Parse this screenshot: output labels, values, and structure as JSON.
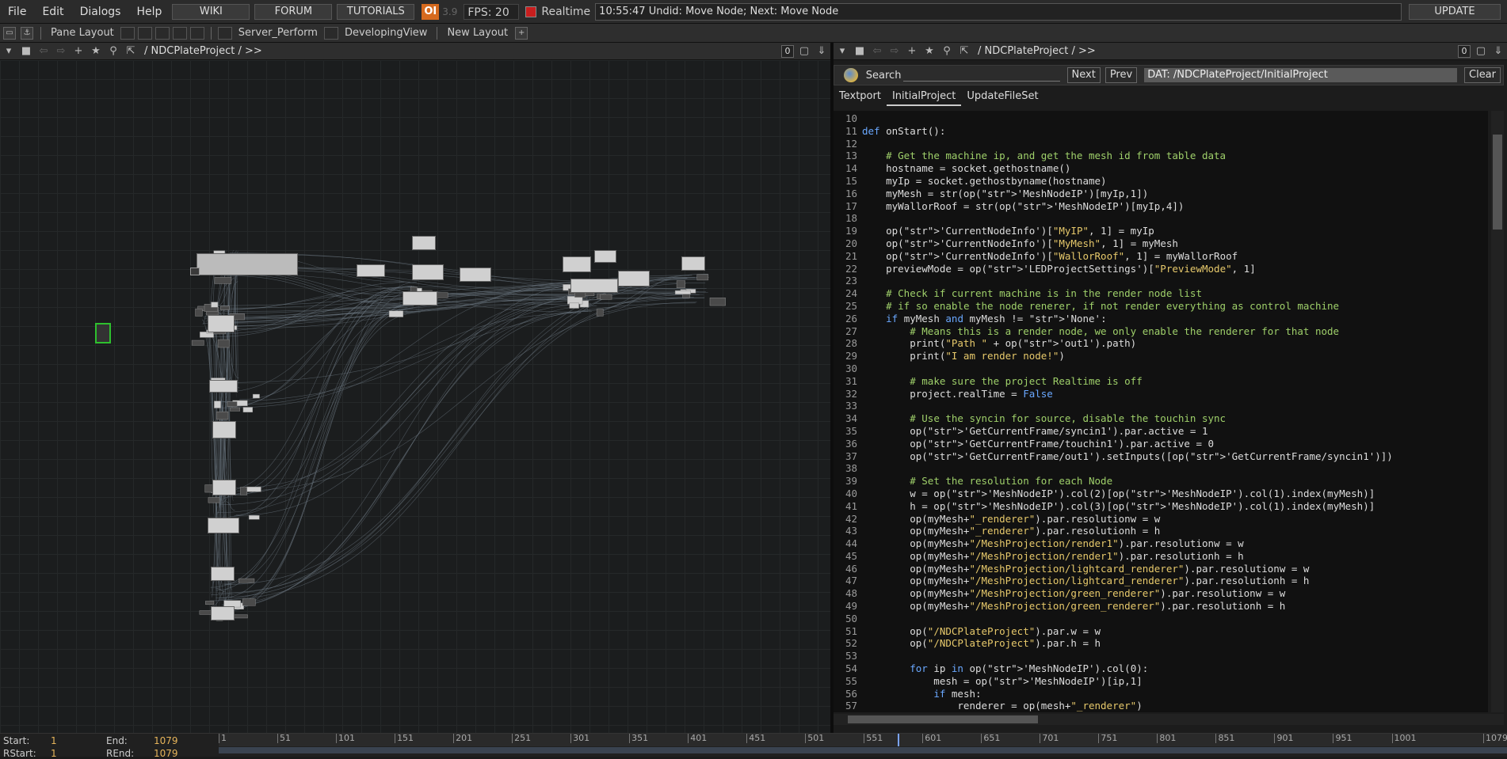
{
  "menu": {
    "file": "File",
    "edit": "Edit",
    "dialogs": "Dialogs",
    "help": "Help",
    "wiki": "WIKI",
    "forum": "FORUM",
    "tutorials": "TUTORIALS",
    "oi": "OI",
    "version": "3.9",
    "fps_label": "FPS:",
    "fps_value": "20",
    "realtime": "Realtime",
    "undo": "10:55:47 Undid: Move Node; Next: Move Node",
    "update": "UPDATE"
  },
  "toolbar": {
    "pane_layout": "Pane Layout",
    "layout1": "Server_Perform",
    "layout2": "DevelopingView",
    "new_layout": "New Layout"
  },
  "left_pane": {
    "path": "/ NDCPlateProject / >>",
    "zoom": "0"
  },
  "right_pane": {
    "path": "/ NDCPlateProject / >>",
    "zoom": "0"
  },
  "search": {
    "label": "Search",
    "next": "Next",
    "prev": "Prev",
    "dat_path": "DAT:  /NDCPlateProject/InitialProject",
    "clear": "Clear"
  },
  "tabs": [
    "Textport",
    "InitialProject",
    "UpdateFileSet"
  ],
  "code": [
    {
      "n": "10",
      "t": ""
    },
    {
      "n": "11",
      "t": "def onStart():"
    },
    {
      "n": "12",
      "t": ""
    },
    {
      "n": "13",
      "t": "    # Get the machine ip, and get the mesh id from table data"
    },
    {
      "n": "14",
      "t": "    hostname = socket.gethostname()"
    },
    {
      "n": "15",
      "t": "    myIp = socket.gethostbyname(hostname)"
    },
    {
      "n": "16",
      "t": "    myMesh = str(op('MeshNodeIP')[myIp,1])"
    },
    {
      "n": "17",
      "t": "    myWallorRoof = str(op('MeshNodeIP')[myIp,4])"
    },
    {
      "n": "18",
      "t": ""
    },
    {
      "n": "19",
      "t": "    op('CurrentNodeInfo')[\"MyIP\", 1] = myIp"
    },
    {
      "n": "20",
      "t": "    op('CurrentNodeInfo')[\"MyMesh\", 1] = myMesh"
    },
    {
      "n": "21",
      "t": "    op('CurrentNodeInfo')[\"WallorRoof\", 1] = myWallorRoof"
    },
    {
      "n": "22",
      "t": "    previewMode = op('LEDProjectSettings')[\"PreviewMode\", 1]"
    },
    {
      "n": "23",
      "t": ""
    },
    {
      "n": "24",
      "t": "    # Check if current machine is in the render node list"
    },
    {
      "n": "25",
      "t": "    # if so enable the node renerer, if not render everything as control machine"
    },
    {
      "n": "26",
      "t": "    if myMesh and myMesh != 'None':"
    },
    {
      "n": "27",
      "t": "        # Means this is a render node, we only enable the renderer for that node"
    },
    {
      "n": "28",
      "t": "        print(\"Path \" + op('out1').path)"
    },
    {
      "n": "29",
      "t": "        print(\"I am render node!\")"
    },
    {
      "n": "30",
      "t": ""
    },
    {
      "n": "31",
      "t": "        # make sure the project Realtime is off"
    },
    {
      "n": "32",
      "t": "        project.realTime = False"
    },
    {
      "n": "33",
      "t": ""
    },
    {
      "n": "34",
      "t": "        # Use the syncin for source, disable the touchin sync"
    },
    {
      "n": "35",
      "t": "        op('GetCurrentFrame/syncin1').par.active = 1"
    },
    {
      "n": "36",
      "t": "        op('GetCurrentFrame/touchin1').par.active = 0"
    },
    {
      "n": "37",
      "t": "        op('GetCurrentFrame/out1').setInputs([op('GetCurrentFrame/syncin1')])"
    },
    {
      "n": "38",
      "t": ""
    },
    {
      "n": "39",
      "t": "        # Set the resolution for each Node"
    },
    {
      "n": "40",
      "t": "        w = op('MeshNodeIP').col(2)[op('MeshNodeIP').col(1).index(myMesh)]"
    },
    {
      "n": "41",
      "t": "        h = op('MeshNodeIP').col(3)[op('MeshNodeIP').col(1).index(myMesh)]"
    },
    {
      "n": "42",
      "t": "        op(myMesh+\"_renderer\").par.resolutionw = w"
    },
    {
      "n": "43",
      "t": "        op(myMesh+\"_renderer\").par.resolutionh = h"
    },
    {
      "n": "44",
      "t": "        op(myMesh+\"/MeshProjection/render1\").par.resolutionw = w"
    },
    {
      "n": "45",
      "t": "        op(myMesh+\"/MeshProjection/render1\").par.resolutionh = h"
    },
    {
      "n": "46",
      "t": "        op(myMesh+\"/MeshProjection/lightcard_renderer\").par.resolutionw = w"
    },
    {
      "n": "47",
      "t": "        op(myMesh+\"/MeshProjection/lightcard_renderer\").par.resolutionh = h"
    },
    {
      "n": "48",
      "t": "        op(myMesh+\"/MeshProjection/green_renderer\").par.resolutionw = w"
    },
    {
      "n": "49",
      "t": "        op(myMesh+\"/MeshProjection/green_renderer\").par.resolutionh = h"
    },
    {
      "n": "50",
      "t": ""
    },
    {
      "n": "51",
      "t": "        op(\"/NDCPlateProject\").par.w = w"
    },
    {
      "n": "52",
      "t": "        op(\"/NDCPlateProject\").par.h = h"
    },
    {
      "n": "53",
      "t": ""
    },
    {
      "n": "54",
      "t": "        for ip in op('MeshNodeIP').col(0):"
    },
    {
      "n": "55",
      "t": "            mesh = op('MeshNodeIP')[ip,1]"
    },
    {
      "n": "56",
      "t": "            if mesh:"
    },
    {
      "n": "57",
      "t": "                renderer = op(mesh+\"_renderer\")"
    }
  ],
  "timeline": {
    "start_label": "Start:",
    "start": "1",
    "end_label": "End:",
    "end": "1079",
    "rstart_label": "RStart:",
    "rstart": "1",
    "rend_label": "REnd:",
    "rend": "1079",
    "ticks": [
      "1",
      "51",
      "101",
      "151",
      "201",
      "251",
      "301",
      "351",
      "401",
      "451",
      "501",
      "551",
      "601",
      "651",
      "701",
      "751",
      "801",
      "851",
      "901",
      "951",
      "1001",
      "1079"
    ]
  }
}
